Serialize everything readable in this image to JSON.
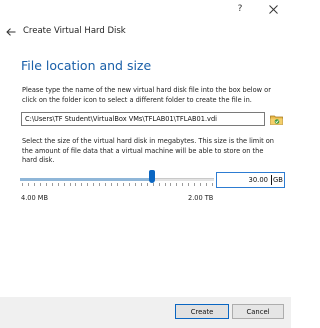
{
  "window": {
    "help_label": "?",
    "close_icon": "close-icon"
  },
  "wizard": {
    "back_icon": "back-arrow-icon",
    "title": "Create Virtual Hard Disk"
  },
  "page": {
    "heading": "File location and size",
    "location_instructions": "Please type the name of the new virtual hard disk file into the box below or click on the folder icon to select a different folder to create the file in.",
    "file_path": "C:\\Users\\TF Student\\VirtualBox VMs\\TFLAB01\\TFLAB01.vdi",
    "folder_icon": "folder-icon",
    "size_instructions": "Select the size of the virtual hard disk in megabytes. This size is the limit on the amount of file data that a virtual machine will be able to store on the hard disk.",
    "slider_position": 0.68,
    "slider_min_label": "4.00 MB",
    "slider_max_label": "2.00 TB",
    "size_value": "30.00",
    "size_unit": "GB"
  },
  "footer": {
    "create_label": "Create",
    "cancel_label": "Cancel"
  },
  "colors": {
    "heading": "#1a5fa8",
    "accent": "#0a66c2",
    "footer_bg": "#f0f0f0"
  }
}
